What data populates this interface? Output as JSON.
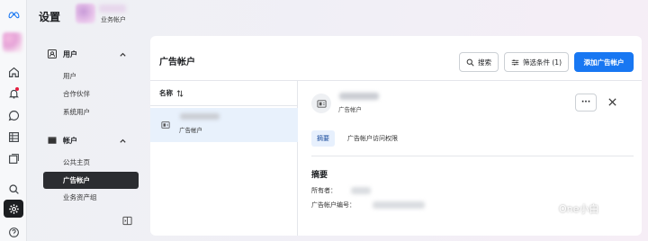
{
  "header": {
    "title": "设置",
    "business_label": "业务帐户"
  },
  "nav": {
    "users_group": "用户",
    "users_items": [
      "用户",
      "合作伙伴",
      "系统用户"
    ],
    "accounts_group": "帐户",
    "accounts_items": [
      "公共主页",
      "广告帐户",
      "业务资产组"
    ]
  },
  "panel": {
    "title": "广告帐户",
    "search_label": "搜索",
    "filter_label": "筛选条件 (1)",
    "add_label": "添加广告帐户",
    "column_name": "名称",
    "row_type": "广告帐户"
  },
  "detail": {
    "type_label": "广告帐户",
    "more_label": "···",
    "tabs": [
      "摘要",
      "广告帐户访问权限"
    ],
    "section_title": "摘要",
    "owner_label": "所有者：",
    "account_id_label": "广告帐户编号："
  },
  "watermark": {
    "text": "One小白"
  },
  "colors": {
    "primary": "#1877f2",
    "active_nav": "#2b2d31",
    "selected_row": "#e8f1fc"
  }
}
